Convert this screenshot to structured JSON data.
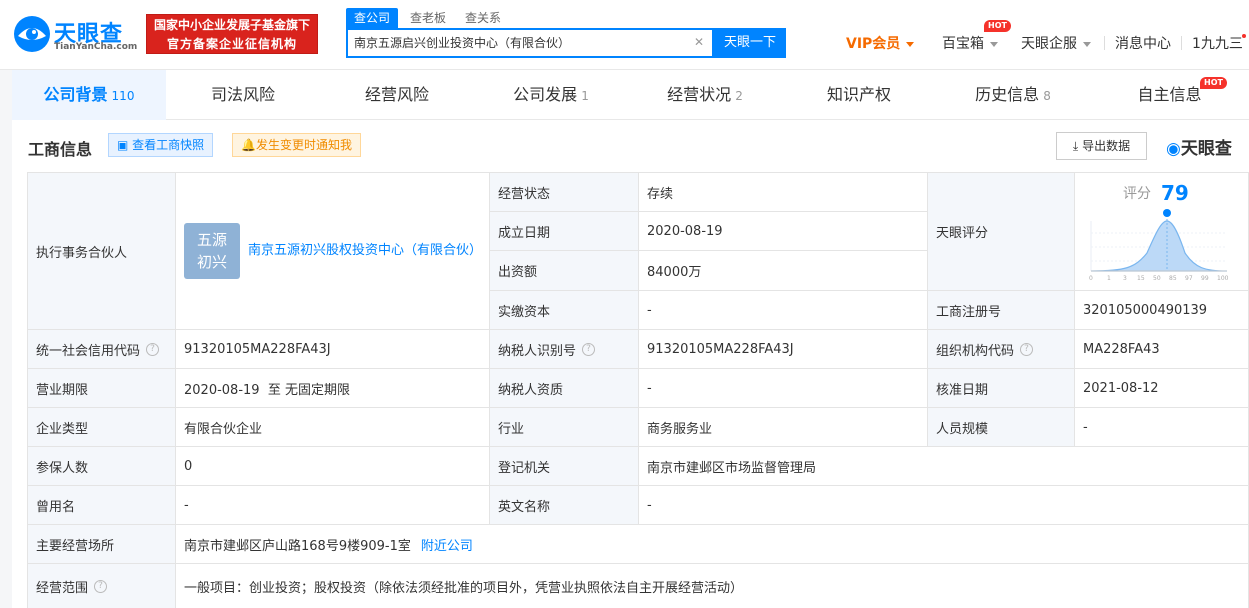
{
  "header": {
    "logo_cn": "天眼查",
    "logo_en": "TianYanCha.com",
    "gov_line1": "国家中小企业发展子基金旗下",
    "gov_line2": "官方备案企业征信机构",
    "search_tabs": [
      "查公司",
      "查老板",
      "查关系"
    ],
    "search_value": "南京五源启兴创业投资中心（有限合伙）",
    "search_button": "天眼一下",
    "nav": {
      "vip": "VIP会员",
      "baibaoxiang": "百宝箱",
      "qifu": "天眼企服",
      "messages": "消息中心",
      "user": "1九九三"
    },
    "hot": "HOT"
  },
  "tabs": [
    {
      "label": "公司背景",
      "count": "110"
    },
    {
      "label": "司法风险",
      "count": ""
    },
    {
      "label": "经营风险",
      "count": ""
    },
    {
      "label": "公司发展",
      "count": "1"
    },
    {
      "label": "经营状况",
      "count": "2"
    },
    {
      "label": "知识产权",
      "count": ""
    },
    {
      "label": "历史信息",
      "count": "8"
    },
    {
      "label": "自主信息",
      "count": ""
    }
  ],
  "section": {
    "title": "工商信息",
    "snapshot": "查看工商快照",
    "notify": "发生变更时通知我",
    "export": "导出数据",
    "brand": "天眼查"
  },
  "info": {
    "partner_label": "执行事务合伙人",
    "partner_avatar_1": "五源",
    "partner_avatar_2": "初兴",
    "partner_name": "南京五源初兴股权投资中心（有限合伙）",
    "status_label": "经营状态",
    "status": "存续",
    "date_label": "成立日期",
    "date": "2020-08-19",
    "capital_label": "出资额",
    "capital": "84000万",
    "paid_label": "实缴资本",
    "paid": "-",
    "score_label": "天眼评分",
    "score_title": "评分",
    "score": "79",
    "score_ticks": [
      "0",
      "1",
      "3",
      "15",
      "50",
      "85",
      "97",
      "99",
      "100"
    ],
    "regno_label": "工商注册号",
    "regno": "320105000490139",
    "credit_label": "统一社会信用代码",
    "credit": "91320105MA228FA43J",
    "taxid_label": "纳税人识别号",
    "taxid": "91320105MA228FA43J",
    "org_label": "组织机构代码",
    "org": "MA228FA43",
    "term_label": "营业期限",
    "term": "2020-08-19  至 无固定期限",
    "taxq_label": "纳税人资质",
    "taxq": "-",
    "approve_label": "核准日期",
    "approve": "2021-08-12",
    "type_label": "企业类型",
    "type": "有限合伙企业",
    "industry_label": "行业",
    "industry": "商务服务业",
    "staff_label": "人员规模",
    "staff": "-",
    "insured_label": "参保人数",
    "insured": "0",
    "authority_label": "登记机关",
    "authority": "南京市建邺区市场监督管理局",
    "former_label": "曾用名",
    "former": "-",
    "en_label": "英文名称",
    "en": "-",
    "addr_label": "主要经营场所",
    "addr": "南京市建邺区庐山路168号9楼909-1室",
    "nearby": "附近公司",
    "scope_label": "经营范围",
    "scope": "一般项目：创业投资；股权投资（除依法须经批准的项目外，凭营业执照依法自主开展经营活动）"
  }
}
